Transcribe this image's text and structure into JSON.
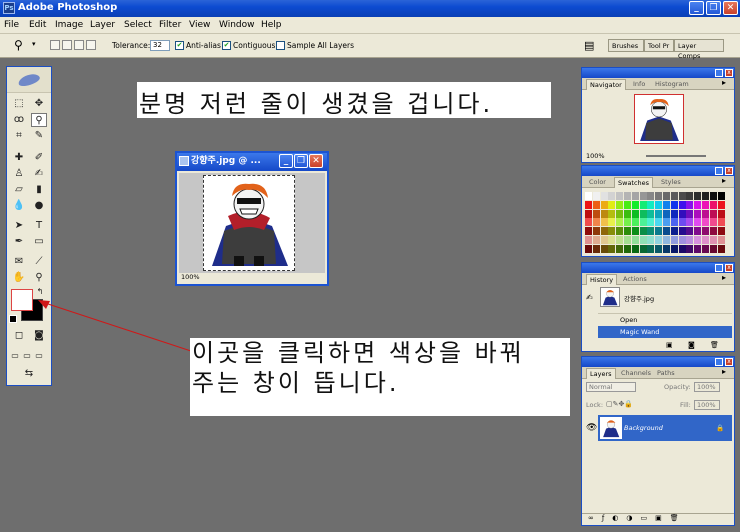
{
  "window": {
    "title": "Adobe Photoshop"
  },
  "menu": [
    "File",
    "Edit",
    "Image",
    "Layer",
    "Select",
    "Filter",
    "View",
    "Window",
    "Help"
  ],
  "options": {
    "tolerance_label": "Tolerance:",
    "tolerance_value": "32",
    "anti_alias_label": "Anti-alias",
    "contiguous_label": "Contiguous",
    "sample_all_label": "Sample All Layers",
    "well_tabs": [
      "Brushes",
      "Tool Pr",
      "Layer Comps"
    ]
  },
  "annotations": {
    "top_note": "분명 저런 줄이 생겼을 겁니다.",
    "bottom_note_line1": "이곳을 클릭하면 색상을 바꿔",
    "bottom_note_line2": "주는 창이 뜹니다."
  },
  "document": {
    "title": "강향주.jpg @ ...",
    "zoom": "100%"
  },
  "navigator": {
    "tabs": [
      "Navigator",
      "Info",
      "Histogram"
    ],
    "zoom": "100%"
  },
  "color_palette": {
    "tabs": [
      "Color",
      "Swatches",
      "Styles"
    ]
  },
  "history": {
    "tabs": [
      "History",
      "Actions"
    ],
    "snapshot": "강향주.jpg",
    "items": [
      "Open",
      "Magic Wand"
    ]
  },
  "layers": {
    "tabs": [
      "Layers",
      "Channels",
      "Paths"
    ],
    "blend_mode": "Normal",
    "opacity_label": "Opacity:",
    "opacity_value": "100%",
    "lock_label": "Lock:",
    "fill_label": "Fill:",
    "fill_value": "100%",
    "layer_name": "Background"
  }
}
